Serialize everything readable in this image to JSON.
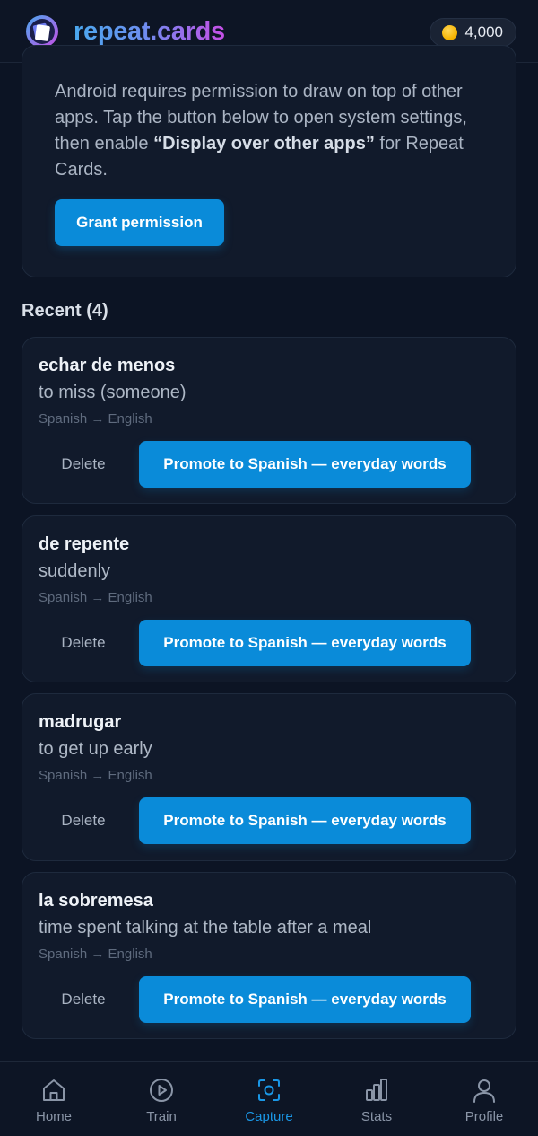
{
  "header": {
    "brand": "repeat.cards",
    "coins": "4,000"
  },
  "permission": {
    "text_before": "Android requires permission to draw on top of other apps. Tap the button below to open system settings, then enable ",
    "text_bold": "“Display over other apps”",
    "text_after": " for Repeat Cards.",
    "button_label": "Grant permission"
  },
  "recent": {
    "title": "Recent (4)",
    "items": [
      {
        "term": "echar de menos",
        "meaning": "to miss (someone)",
        "lang": "Spanish → English",
        "delete_label": "Delete",
        "promote_label": "Promote to Spanish — everyday words"
      },
      {
        "term": "de repente",
        "meaning": "suddenly",
        "lang": "Spanish → English",
        "delete_label": "Delete",
        "promote_label": "Promote to Spanish — everyday words"
      },
      {
        "term": "madrugar",
        "meaning": "to get up early",
        "lang": "Spanish → English",
        "delete_label": "Delete",
        "promote_label": "Promote to Spanish — everyday words"
      },
      {
        "term": "la sobremesa",
        "meaning": "time spent talking at the table after a meal",
        "lang": "Spanish → English",
        "delete_label": "Delete",
        "promote_label": "Promote to Spanish — everyday words"
      }
    ]
  },
  "nav": {
    "items": [
      {
        "label": "Home",
        "icon": "home-icon"
      },
      {
        "label": "Train",
        "icon": "play-icon"
      },
      {
        "label": "Capture",
        "icon": "capture-icon",
        "active": true
      },
      {
        "label": "Stats",
        "icon": "stats-icon"
      },
      {
        "label": "Profile",
        "icon": "profile-icon"
      }
    ]
  },
  "colors": {
    "background": "#0c1424",
    "card": "#111a2b",
    "accent": "#0a8bd9",
    "active_nav": "#1a97e6",
    "coin": "#f5b300"
  }
}
